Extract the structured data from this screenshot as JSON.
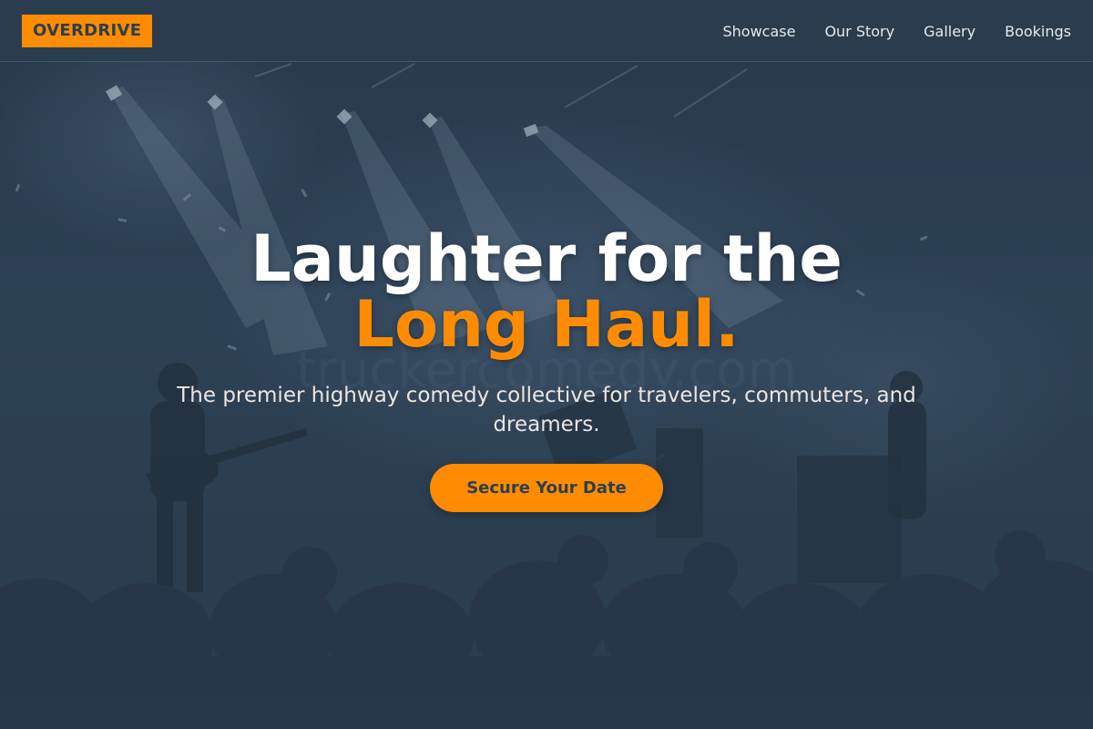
{
  "navbar": {
    "logo_text": "OVERDRIVE",
    "links": [
      {
        "label": "Showcase"
      },
      {
        "label": "Our Story"
      },
      {
        "label": "Gallery"
      },
      {
        "label": "Bookings"
      }
    ]
  },
  "hero": {
    "headline_line1": "Laughter for the",
    "headline_line2": "Long Haul.",
    "subheadline": "The premier highway comedy collective for travelers, commuters, and dreamers.",
    "cta_label": "Secure Your Date",
    "background_image": "concert-stage-crowd-silhouette",
    "watermark_text": "truckercomedy.com"
  },
  "colors": {
    "accent": "#ff8c00",
    "primary_dark": "#2c3e50",
    "text_light": "#ffffff"
  }
}
